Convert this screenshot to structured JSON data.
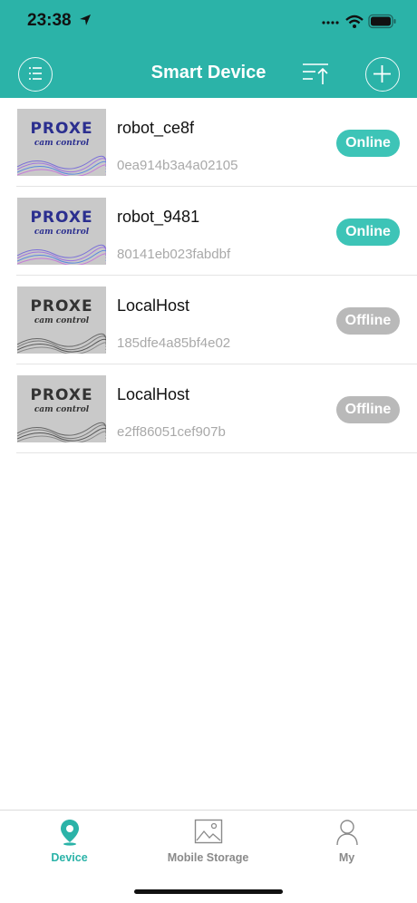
{
  "status_bar": {
    "time": "23:38"
  },
  "header": {
    "title": "Smart Device"
  },
  "devices": [
    {
      "name": "robot_ce8f",
      "id": "0ea914b3a4a02105",
      "status": "Online",
      "logo": "PROXE",
      "logo_sub": "cam control"
    },
    {
      "name": "robot_9481",
      "id": "80141eb023fabdbf",
      "status": "Online",
      "logo": "PROXE",
      "logo_sub": "cam control"
    },
    {
      "name": "LocalHost",
      "id": "185dfe4a85bf4e02",
      "status": "Offline",
      "logo": "PROXE",
      "logo_sub": "cam control"
    },
    {
      "name": "LocalHost",
      "id": "e2ff86051cef907b",
      "status": "Offline",
      "logo": "PROXE",
      "logo_sub": "cam control"
    }
  ],
  "tabs": [
    {
      "label": "Device",
      "icon": "location-pin-icon",
      "active": true
    },
    {
      "label": "Mobile Storage",
      "icon": "image-icon",
      "active": false
    },
    {
      "label": "My",
      "icon": "person-icon",
      "active": false
    }
  ],
  "colors": {
    "accent": "#2bb3a8",
    "online": "#3dc4b7",
    "offline": "#b9b9b9"
  }
}
